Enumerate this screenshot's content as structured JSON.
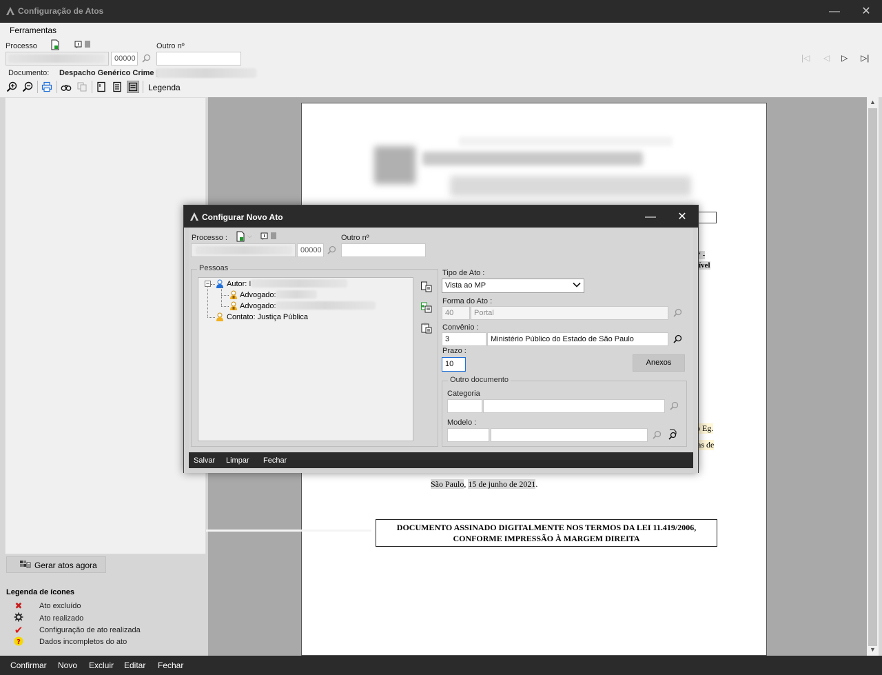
{
  "window": {
    "title": "Configuração de Atos"
  },
  "menu": {
    "ferramentas": "Ferramentas"
  },
  "header": {
    "processo_label": "Processo",
    "processo_num": "00000",
    "outro_label": "Outro nº",
    "documento_label": "Documento:",
    "documento_value": "Despacho Genérico Crime [0",
    "legenda_label": "Legenda"
  },
  "left": {
    "gerar_button": "Gerar atos agora",
    "legend_title": "Legenda de ícones",
    "legend_items": [
      {
        "label": "Ato excluído"
      },
      {
        "label": "Ato realizado"
      },
      {
        "label": "Configuração de ato realizada"
      },
      {
        "label": "Dados incompletos do ato"
      }
    ]
  },
  "doc": {
    "fragment1": "“ -",
    "fragment2": "ível",
    "fragment3": "o Eg.",
    "fragment4": "as de",
    "city": "São Paulo",
    "date": "15 de junho de 2021",
    "signature_line1": "DOCUMENTO ASSINADO DIGITALMENTE NOS TERMOS DA LEI 11.419/2006,",
    "signature_line2": "CONFORME IMPRESSÃO À MARGEM DIREITA"
  },
  "dialog": {
    "title": "Configurar Novo Ato",
    "processo_label": "Processo :",
    "processo_num": "00000",
    "outro_label": "Outro nº",
    "pessoas_label": "Pessoas",
    "tree": {
      "autor": "Autor: I",
      "advogado1": "Advogado:",
      "advogado2": "Advogado:",
      "contato": "Contato: Justiça Pública"
    },
    "tipo_label": "Tipo de Ato :",
    "tipo_value": "Vista ao MP",
    "forma_label": "Forma do Ato :",
    "forma_code": "40",
    "forma_value": "Portal",
    "convenio_label": "Convênio :",
    "convenio_code": "3",
    "convenio_value": "Ministério Público do Estado de São Paulo",
    "prazo_label": "Prazo :",
    "prazo_value": "10",
    "anexos_button": "Anexos",
    "outro_doc_label": "Outro documento",
    "categoria_label": "Categoria",
    "modelo_label": "Modelo :",
    "footer": {
      "salvar": "Salvar",
      "limpar": "Limpar",
      "fechar": "Fechar"
    }
  },
  "bottom": {
    "confirmar": "Confirmar",
    "novo": "Novo",
    "excluir": "Excluir",
    "editar": "Editar",
    "fechar": "Fechar"
  },
  "colors": {
    "titlebar": "#2b2b2b",
    "accent_blue": "#1e6fd9",
    "excluded_red": "#c81e1e",
    "check_red": "#e01818",
    "warn_yellow": "#f5d800"
  }
}
